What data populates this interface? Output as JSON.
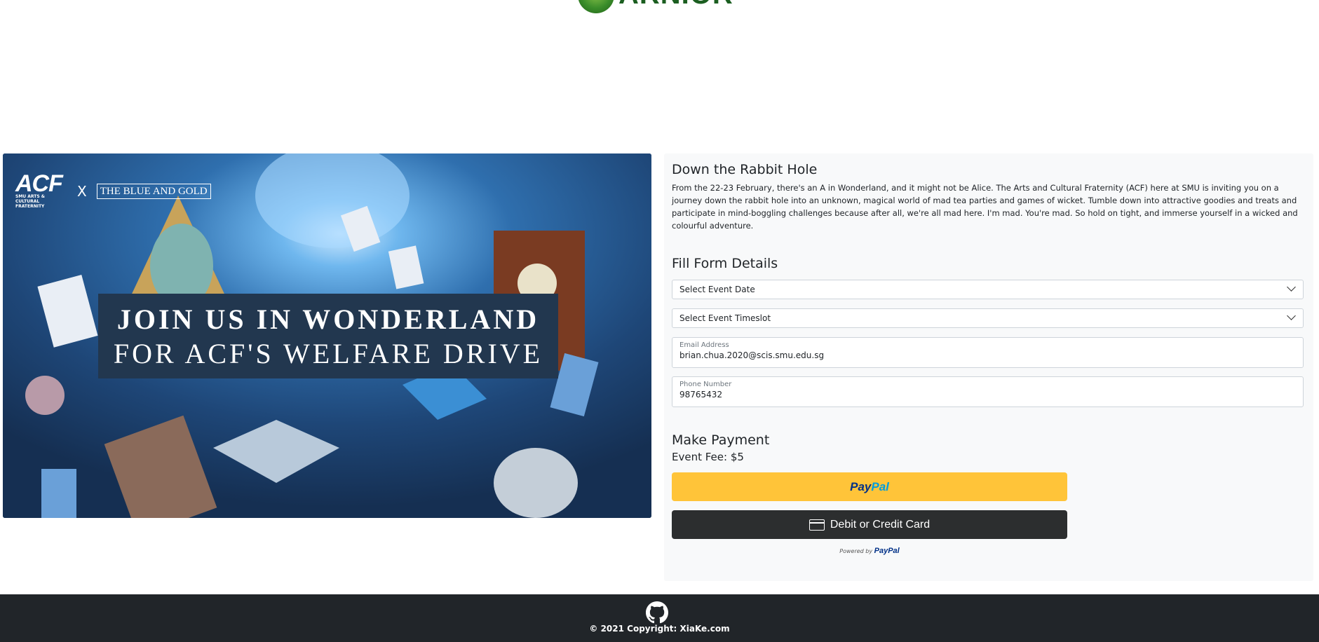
{
  "header": {
    "logo_text": "ARNIOR"
  },
  "banner": {
    "acf_logo": "ACF",
    "acf_subtitle": "SMU ARTS & CULTURAL FRATERNITY",
    "cross": "X",
    "partner_logo": "THE BLUE AND GOLD",
    "headline_1": "JOIN US IN WONDERLAND",
    "headline_2": "FOR ACF'S WELFARE DRIVE"
  },
  "event": {
    "title": "Down the Rabbit Hole",
    "description": "From the 22-23 February, there's an A in Wonderland, and it might not be Alice. The Arts and Cultural Fraternity (ACF) here at SMU is inviting you on a journey down the rabbit hole into an unknown, magical world of mad tea parties and games of wicket. Tumble down into attractive goodies and treats and participate in mind-boggling challenges because after all, we're all mad here. I'm mad. You're mad. So hold on tight, and immerse yourself in a wicked and colourful adventure."
  },
  "form": {
    "title": "Fill Form Details",
    "date_select": "Select Event Date",
    "timeslot_select": "Select Event Timeslot",
    "email_label": "Email Address",
    "email_value": "brian.chua.2020@scis.smu.edu.sg",
    "phone_label": "Phone Number",
    "phone_value": "98765432"
  },
  "payment": {
    "title": "Make Payment",
    "fee": "Event Fee: $5",
    "paypal_dark": "Pay",
    "paypal_light": "Pal",
    "card_button": "Debit or Credit Card",
    "powered_by": "Powered by",
    "powered_brand": "PayPal"
  },
  "footer": {
    "copyright": "© 2021 Copyright: XiaKe.com"
  },
  "colors": {
    "paypal_yellow": "#ffc439",
    "card_dark": "#2c2e2f",
    "footer_bg": "#212529",
    "panel_bg": "#f8f9fa"
  }
}
